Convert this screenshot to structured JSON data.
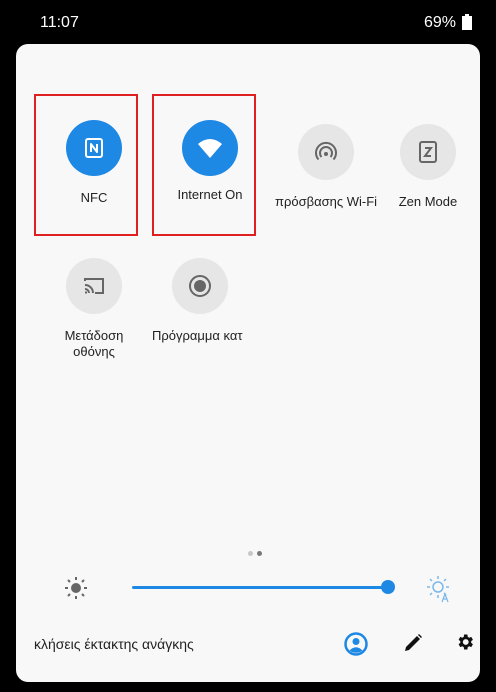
{
  "status_bar": {
    "time": "11:07",
    "battery_percent": "69%"
  },
  "tiles": [
    {
      "label": "NFC",
      "icon": "nfc-icon",
      "state": "active",
      "highlighted": true
    },
    {
      "label": "Internet On",
      "icon": "wifi-icon",
      "state": "active",
      "highlighted": true
    },
    {
      "label": "πρόσβασης Wi-Fi",
      "icon": "hotspot-icon",
      "state": "inactive",
      "highlighted": false
    },
    {
      "label": "Zen Mode",
      "icon": "zen-mode-icon",
      "state": "inactive",
      "highlighted": false
    },
    {
      "label": "Μετάδοση οθόνης",
      "icon": "cast-screen-icon",
      "state": "inactive",
      "highlighted": false
    },
    {
      "label": "Πρόγραμμα κατ",
      "icon": "record-icon",
      "state": "inactive",
      "highlighted": false
    }
  ],
  "pager": {
    "pages": 2,
    "current": 2
  },
  "brightness": {
    "level": 1.0
  },
  "bottom_bar": {
    "emergency_text": "κλήσεις έκτακτης ανάγκης",
    "icons": [
      "user-account-icon",
      "edit-pencil-icon",
      "settings-gear-icon"
    ]
  },
  "colors": {
    "accent": "#1e88e5",
    "highlight_box": "#e02020",
    "panel_bg": "#f8f8f8"
  }
}
